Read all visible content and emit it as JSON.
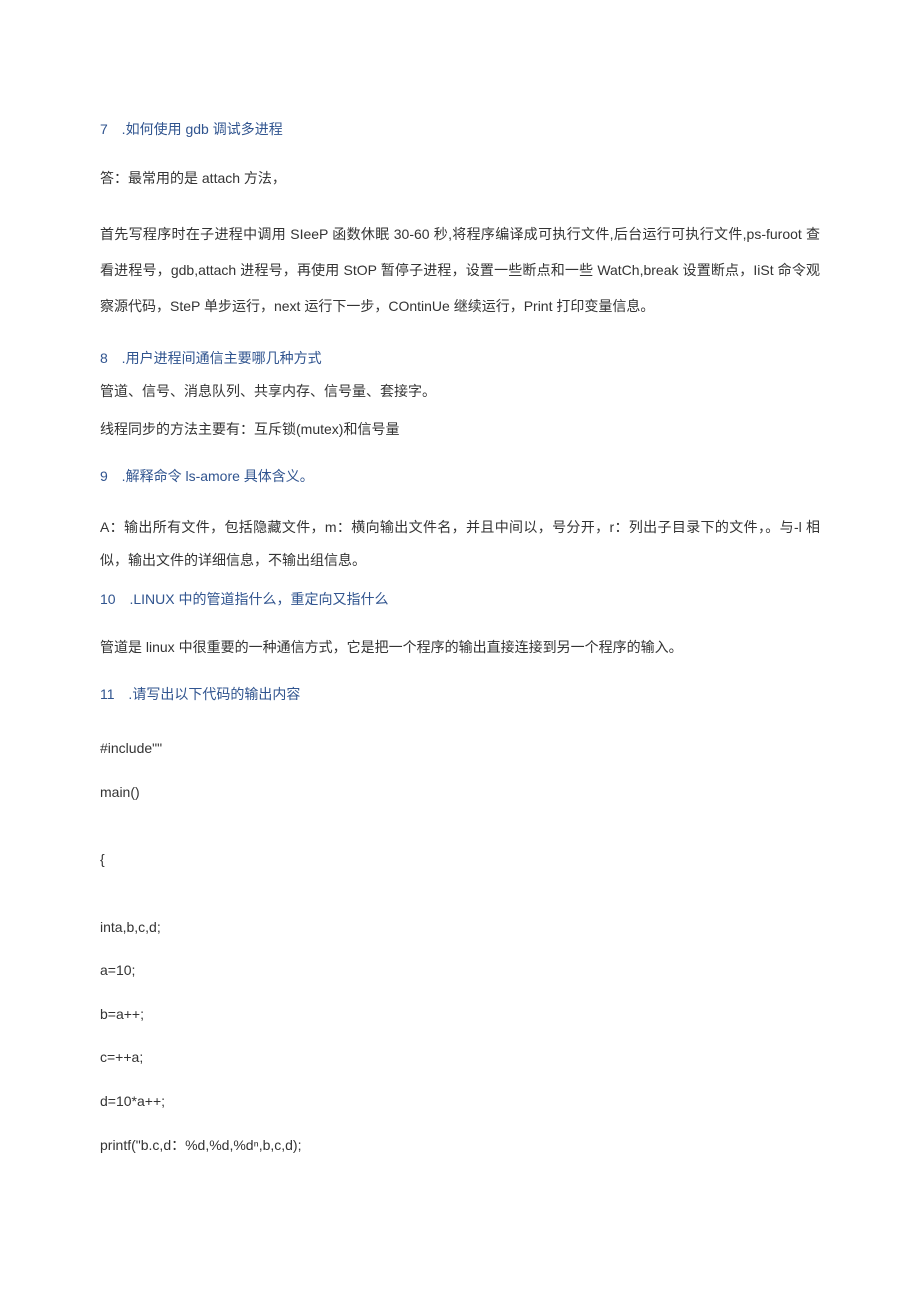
{
  "q7": {
    "num": "7",
    "title": " .如何使用 gdb 调试多进程",
    "a1": "答：最常用的是 attach 方法，",
    "a2": "首先写程序时在子进程中调用 SIeeP 函数休眠 30-60 秒,将程序编译成可执行文件,后台运行可执行文件,ps-furoot 查看进程号，gdb,attach 进程号，再使用 StOP 暂停子进程，设置一些断点和一些 WatCh,break 设置断点，IiSt 命令观察源代码，SteP 单步运行，next 运行下一步，COntinUe 继续运行，Print 打印变量信息。"
  },
  "q8": {
    "num": "8",
    "title": " .用户进程间通信主要哪几种方式",
    "a1": "管道、信号、消息队列、共享内存、信号量、套接字。",
    "a2": "线程同步的方法主要有：互斥锁(mutex)和信号量"
  },
  "q9": {
    "num": "9",
    "title": " .解释命令 ls-amore 具体含义。",
    "a1": "A：输出所有文件，包括隐藏文件，m：横向输出文件名，并且中间以，号分开，r：列出子目录下的文件，。与-l 相似，输出文件的详细信息，不输出组信息。"
  },
  "q10": {
    "num": "10",
    "title": " .LINUX 中的管道指什么，重定向又指什么",
    "a1": "管道是 linux 中很重要的一种通信方式，它是把一个程序的输出直接连接到另一个程序的输入。"
  },
  "q11": {
    "num": "11",
    "title": " .请写出以下代码的输出内容",
    "code": {
      "l1": "#include\"\"",
      "l2": "main()",
      "l3": "{",
      "l4": "inta,b,c,d;",
      "l5": "a=10;",
      "l6": "b=a++;",
      "l7": "c=++a;",
      "l8": "d=10*a++;",
      "l9": "printf(\"b.c,d：%d,%d,%dⁿ,b,c,d);"
    }
  }
}
